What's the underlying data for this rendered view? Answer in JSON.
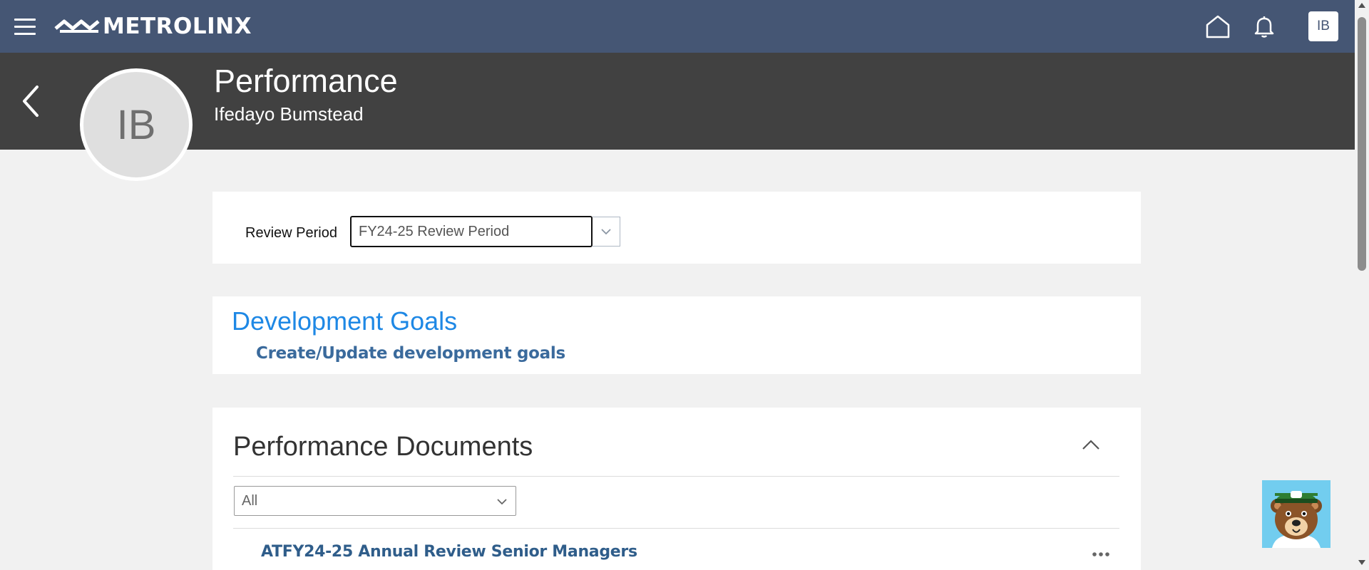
{
  "header": {
    "brand": "METROLINX",
    "user_initials": "IB",
    "icons": [
      "hamburger-icon",
      "home-icon",
      "bell-icon"
    ],
    "background_color": "#455674"
  },
  "profile": {
    "title": "Performance",
    "name": "Ifedayo Bumstead",
    "avatar_initials": "IB",
    "background_color": "#414141"
  },
  "review_period": {
    "label": "Review Period",
    "selected": "FY24-25 Review Period"
  },
  "development_goals": {
    "title": "Development Goals",
    "link": "Create/Update development goals",
    "title_color": "#1e88e5"
  },
  "performance_documents": {
    "title": "Performance Documents",
    "filter_selected": "All",
    "items": [
      {
        "label": "ATFY24-25 Annual Review Senior Managers"
      }
    ]
  }
}
